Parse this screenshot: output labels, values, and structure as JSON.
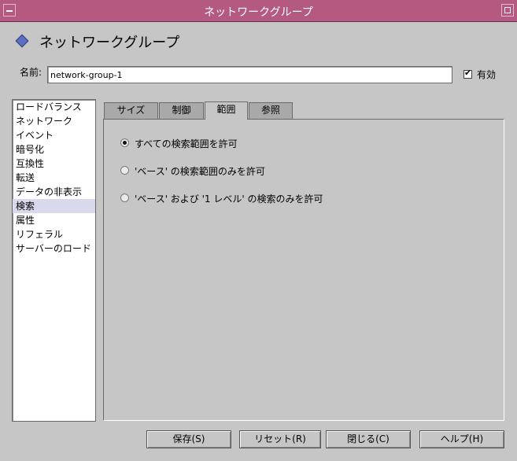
{
  "window": {
    "title": "ネットワークグループ"
  },
  "header": {
    "heading": "ネットワークグループ"
  },
  "name_field": {
    "label": "名前:",
    "value": "network-group-1"
  },
  "enabled": {
    "label": "有効",
    "checked": true
  },
  "sidebar": {
    "items": [
      {
        "label": "ロードバランス",
        "selected": false
      },
      {
        "label": "ネットワーク",
        "selected": false
      },
      {
        "label": "イベント",
        "selected": false
      },
      {
        "label": "暗号化",
        "selected": false
      },
      {
        "label": "互換性",
        "selected": false
      },
      {
        "label": "転送",
        "selected": false
      },
      {
        "label": "データの非表示",
        "selected": false
      },
      {
        "label": "検索",
        "selected": true
      },
      {
        "label": "属性",
        "selected": false
      },
      {
        "label": "リフェラル",
        "selected": false
      },
      {
        "label": "サーバーのロード",
        "selected": false
      }
    ]
  },
  "tabs": [
    {
      "label": "サイズ",
      "active": false
    },
    {
      "label": "制御",
      "active": false
    },
    {
      "label": "範囲",
      "active": true
    },
    {
      "label": "参照",
      "active": false
    }
  ],
  "scope_options": [
    {
      "label": "すべての検索範囲を許可",
      "checked": true
    },
    {
      "label": "'ベース' の検索範囲のみを許可",
      "checked": false
    },
    {
      "label": "'ベース' および '1 レベル' の検索のみを許可",
      "checked": false
    }
  ],
  "buttons": {
    "save": "保存(S)",
    "reset": "リセット(R)",
    "close": "閉じる(C)",
    "help": "ヘルプ(H)"
  }
}
